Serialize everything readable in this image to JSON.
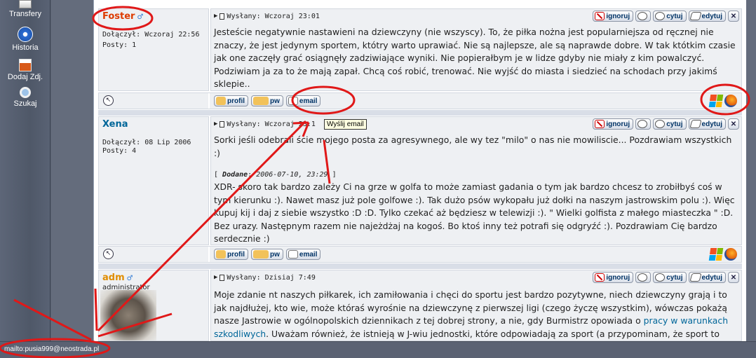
{
  "sidebar": {
    "items": [
      {
        "label": "Transfery",
        "icon": "transfer-icon"
      },
      {
        "label": "Historia",
        "icon": "history-clock-icon"
      },
      {
        "label": "Dodaj Zdj.",
        "icon": "add-photo-icon"
      },
      {
        "label": "Szukaj",
        "icon": "search-icon"
      }
    ]
  },
  "buttons": {
    "ignore": "ignoruj",
    "quote": "cytuj",
    "edit": "edytuj",
    "close": "✕",
    "profile": "profil",
    "pm": "pw",
    "email": "email"
  },
  "tooltip": "Wyślij email",
  "status_text": "mailto:pusia999@neostrada.pl",
  "posts": [
    {
      "author": "Foster",
      "joined": "Dołączył: Wczoraj 22:56",
      "posts": "Posty: 1",
      "sent": "Wysłany: Wczoraj 23:01",
      "body": "Jesteście negatywnie nastawieni na dziewczyny (nie wszyscy). To, że piłka nożna jest popularniejsza od ręcznej nie znaczy, że jest jedynym sportem, któtry warto uprawiać. Nie są najlepsze, ale są naprawde dobre. W tak któtkim czasie jak one zaczęły grać osiągnęły zadziwiające wyniki. Nie popierałbym je w lidze gdyby nie miały z kim powalczyć. Podziwiam ja za to że mają zapał. Chcą coś robić, trenować. Nie wyjść do miasta i siedzieć na schodach przy jakimś sklepie.."
    },
    {
      "author": "Xena",
      "joined": "Dołączył: 08 Lip 2006",
      "posts": "Posty: 4",
      "sent": "Wysłany: Wczoraj 23:1",
      "body": "Sorki jeśli odebrali ście mojego posta za agresywnego, ale wy tez \"milo\" o nas nie mowiliscie... Pozdrawiam wszystkich :)",
      "added_label": "Dodane",
      "added_date": "2006-07-10, 23:29",
      "body2": "XDR- skoro tak bardzo zależy Ci na grze w golfa to może zamiast gadania o tym jak bardzo chcesz to zrobiłbyś coś w tym kierunku :). Nawet masz już pole golfowe :). Tak dużo psów wykopału już dołki na naszym jastrowskim polu :). Więc kupuj kij i daj z siebie wszystko :D :D. Tylko czekać aż będziesz w telewizji :). \" Wielki golfista z małego miasteczka \" :D. Bez urazy. Następnym razem nie najeżdżaj na kogoś. Bo ktoś inny też potrafi się odgryźć :). Pozdrawiam Cię bardzo serdecznie :)"
    },
    {
      "author": "adm",
      "role": "administrator",
      "sent": "Wysłany: Dzisiaj 7:49",
      "body_a": "Moje zdanie nt naszych piłkarek, ich zamiłowania i chęci do sportu jest bardzo pozytywne, niech dziewczyny grają i to jak najdłużej, kto wie, może któraś wyrośnie na dziewczynę z pierwszej ligi (czego życzę wszystkim), wówczas pokażą nasze Jastrowie w ogólnopolskich dziennikach z tej dobrej strony, a nie, gdy Burmistrz opowiada o ",
      "body_link": "pracy w warunkach szkodliwych",
      "body_b": ". Uważam również, że istnieją w J-wiu jednostki, które odpowiadają za sport (a przypominam, że sport to"
    }
  ]
}
